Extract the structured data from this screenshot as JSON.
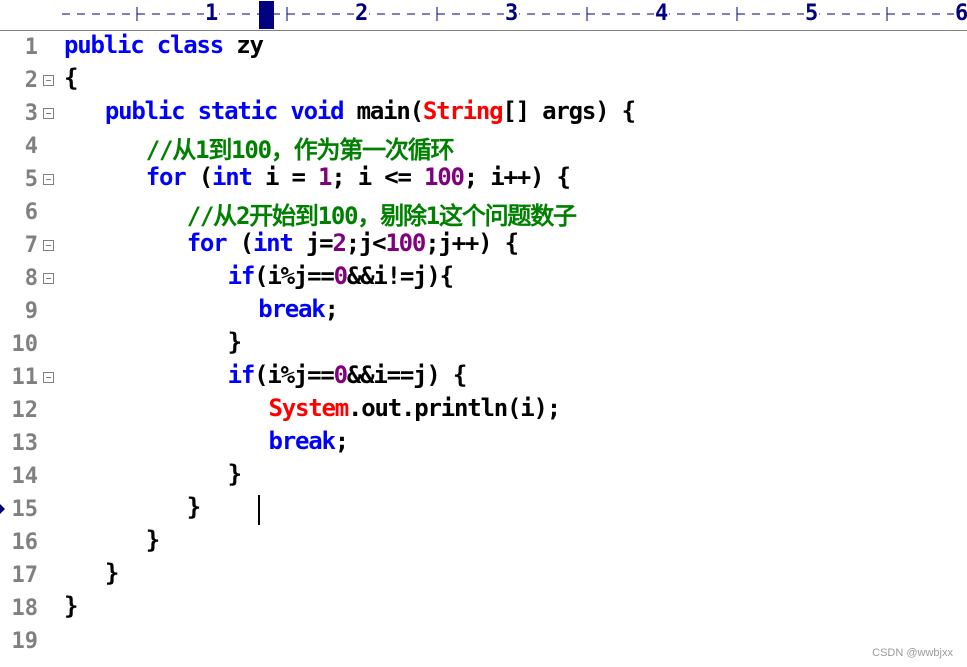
{
  "ruler": {
    "numbers": [
      "1",
      "2",
      "3",
      "4",
      "5",
      "6"
    ]
  },
  "editor": {
    "caret_line": 15,
    "lines": [
      {
        "num": "1",
        "fold": false,
        "indent": 0,
        "tokens": [
          [
            "kw",
            "public class"
          ],
          [
            "t",
            " zy"
          ]
        ]
      },
      {
        "num": "2",
        "fold": true,
        "indent": 0,
        "tokens": [
          [
            "t",
            "{"
          ]
        ]
      },
      {
        "num": "3",
        "fold": true,
        "indent": 4,
        "tokens": [
          [
            "kw",
            "public static void"
          ],
          [
            "t",
            " main("
          ],
          [
            "cls",
            "String"
          ],
          [
            "t",
            "[] args) {"
          ]
        ]
      },
      {
        "num": "4",
        "fold": false,
        "indent": 8,
        "tokens": [
          [
            "cmt",
            "//从1到100，作为第一次循环"
          ]
        ]
      },
      {
        "num": "5",
        "fold": true,
        "indent": 8,
        "tokens": [
          [
            "kw",
            "for"
          ],
          [
            "t",
            " ("
          ],
          [
            "kw",
            "int"
          ],
          [
            "t",
            " i = "
          ],
          [
            "num",
            "1"
          ],
          [
            "t",
            "; i <= "
          ],
          [
            "num",
            "100"
          ],
          [
            "t",
            "; i++) {"
          ]
        ]
      },
      {
        "num": "6",
        "fold": false,
        "indent": 12,
        "tokens": [
          [
            "cmt",
            "//从2开始到100，剔除1这个问题数子"
          ]
        ]
      },
      {
        "num": "7",
        "fold": true,
        "indent": 12,
        "tokens": [
          [
            "kw",
            "for"
          ],
          [
            "t",
            " ("
          ],
          [
            "kw",
            "int"
          ],
          [
            "t",
            " j="
          ],
          [
            "num",
            "2"
          ],
          [
            "t",
            ";j<"
          ],
          [
            "num",
            "100"
          ],
          [
            "t",
            ";j++) {"
          ]
        ]
      },
      {
        "num": "8",
        "fold": true,
        "indent": 16,
        "tokens": [
          [
            "kw",
            "if"
          ],
          [
            "t",
            "(i%j=="
          ],
          [
            "num",
            "0"
          ],
          [
            "t",
            "&&i!=j){"
          ]
        ]
      },
      {
        "num": "9",
        "fold": false,
        "indent": 19,
        "tokens": [
          [
            "kw",
            "break"
          ],
          [
            "t",
            ";"
          ]
        ]
      },
      {
        "num": "10",
        "fold": false,
        "indent": 16,
        "tokens": [
          [
            "t",
            "}"
          ]
        ]
      },
      {
        "num": "11",
        "fold": true,
        "indent": 16,
        "tokens": [
          [
            "kw",
            "if"
          ],
          [
            "t",
            "(i%j=="
          ],
          [
            "num",
            "0"
          ],
          [
            "t",
            "&&i==j) {"
          ]
        ]
      },
      {
        "num": "12",
        "fold": false,
        "indent": 20,
        "tokens": [
          [
            "cls",
            "System"
          ],
          [
            "t",
            ".out.println(i);"
          ]
        ]
      },
      {
        "num": "13",
        "fold": false,
        "indent": 20,
        "tokens": [
          [
            "kw",
            "break"
          ],
          [
            "t",
            ";"
          ]
        ]
      },
      {
        "num": "14",
        "fold": false,
        "indent": 16,
        "tokens": [
          [
            "t",
            "}"
          ]
        ]
      },
      {
        "num": "15",
        "fold": false,
        "indent": 12,
        "tokens": [
          [
            "t",
            "}"
          ]
        ]
      },
      {
        "num": "16",
        "fold": false,
        "indent": 8,
        "tokens": [
          [
            "t",
            "}"
          ]
        ]
      },
      {
        "num": "17",
        "fold": false,
        "indent": 4,
        "tokens": [
          [
            "t",
            "}"
          ]
        ]
      },
      {
        "num": "18",
        "fold": false,
        "indent": 0,
        "tokens": [
          [
            "t",
            "}"
          ]
        ]
      },
      {
        "num": "19",
        "fold": false,
        "indent": 0,
        "tokens": []
      }
    ]
  },
  "watermark": "CSDN @wwbjxx"
}
